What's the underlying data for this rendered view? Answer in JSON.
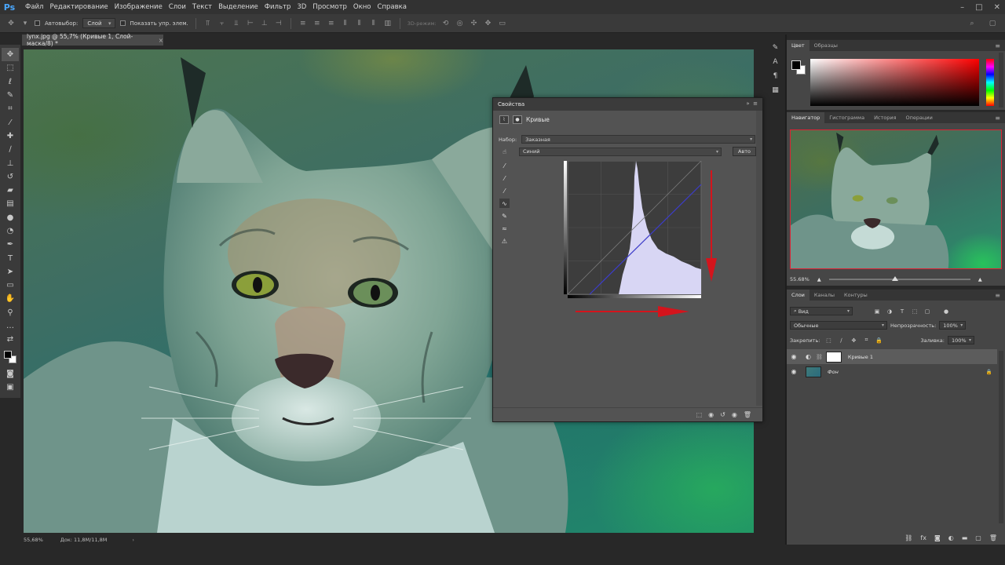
{
  "app": {
    "logo": "Ps"
  },
  "menu": [
    "Файл",
    "Редактирование",
    "Изображение",
    "Слои",
    "Текст",
    "Выделение",
    "Фильтр",
    "3D",
    "Просмотр",
    "Окно",
    "Справка"
  ],
  "options_bar": {
    "autoselect_label": "Автовыбор:",
    "autoselect_value": "Слой",
    "show_transform_label": "Показать упр. элем.",
    "mode_3d_label": "3D-режим:"
  },
  "document": {
    "tab_title": "lynx.jpg @ 55,7% (Кривые 1, Слой-маска/8) *",
    "close": "×",
    "zoom": "55,68%",
    "doc_info": "Док: 11,8M/11,8M"
  },
  "properties": {
    "panel_title": "Свойства",
    "adjustment_name": "Кривые",
    "preset_label": "Набор:",
    "preset_value": "Заказная",
    "channel_value": "Синий",
    "auto_button": "Авто"
  },
  "color_panel": {
    "tabs": [
      "Цвет",
      "Образцы"
    ],
    "active_tab": 0
  },
  "navigator_panel": {
    "tabs": [
      "Навигатор",
      "Гистограмма",
      "История",
      "Операции"
    ],
    "active_tab": 0,
    "zoom": "55.68%"
  },
  "layers_panel": {
    "tabs": [
      "Слои",
      "Каналы",
      "Контуры"
    ],
    "active_tab": 0,
    "filter_kind": "Вид",
    "blend_mode": "Обычные",
    "opacity_label": "Непрозрачность:",
    "opacity_value": "100%",
    "lock_label": "Закрепить:",
    "fill_label": "Заливка:",
    "fill_value": "100%",
    "layers": [
      {
        "name": "Кривые 1",
        "selected": true,
        "visible": true
      },
      {
        "name": "Фон",
        "selected": false,
        "visible": true,
        "locked": true
      }
    ]
  },
  "colors": {
    "accent_red": "#d4141c",
    "curve_fill": "#d8d6f4",
    "blue_curve": "#3c3cc8"
  }
}
